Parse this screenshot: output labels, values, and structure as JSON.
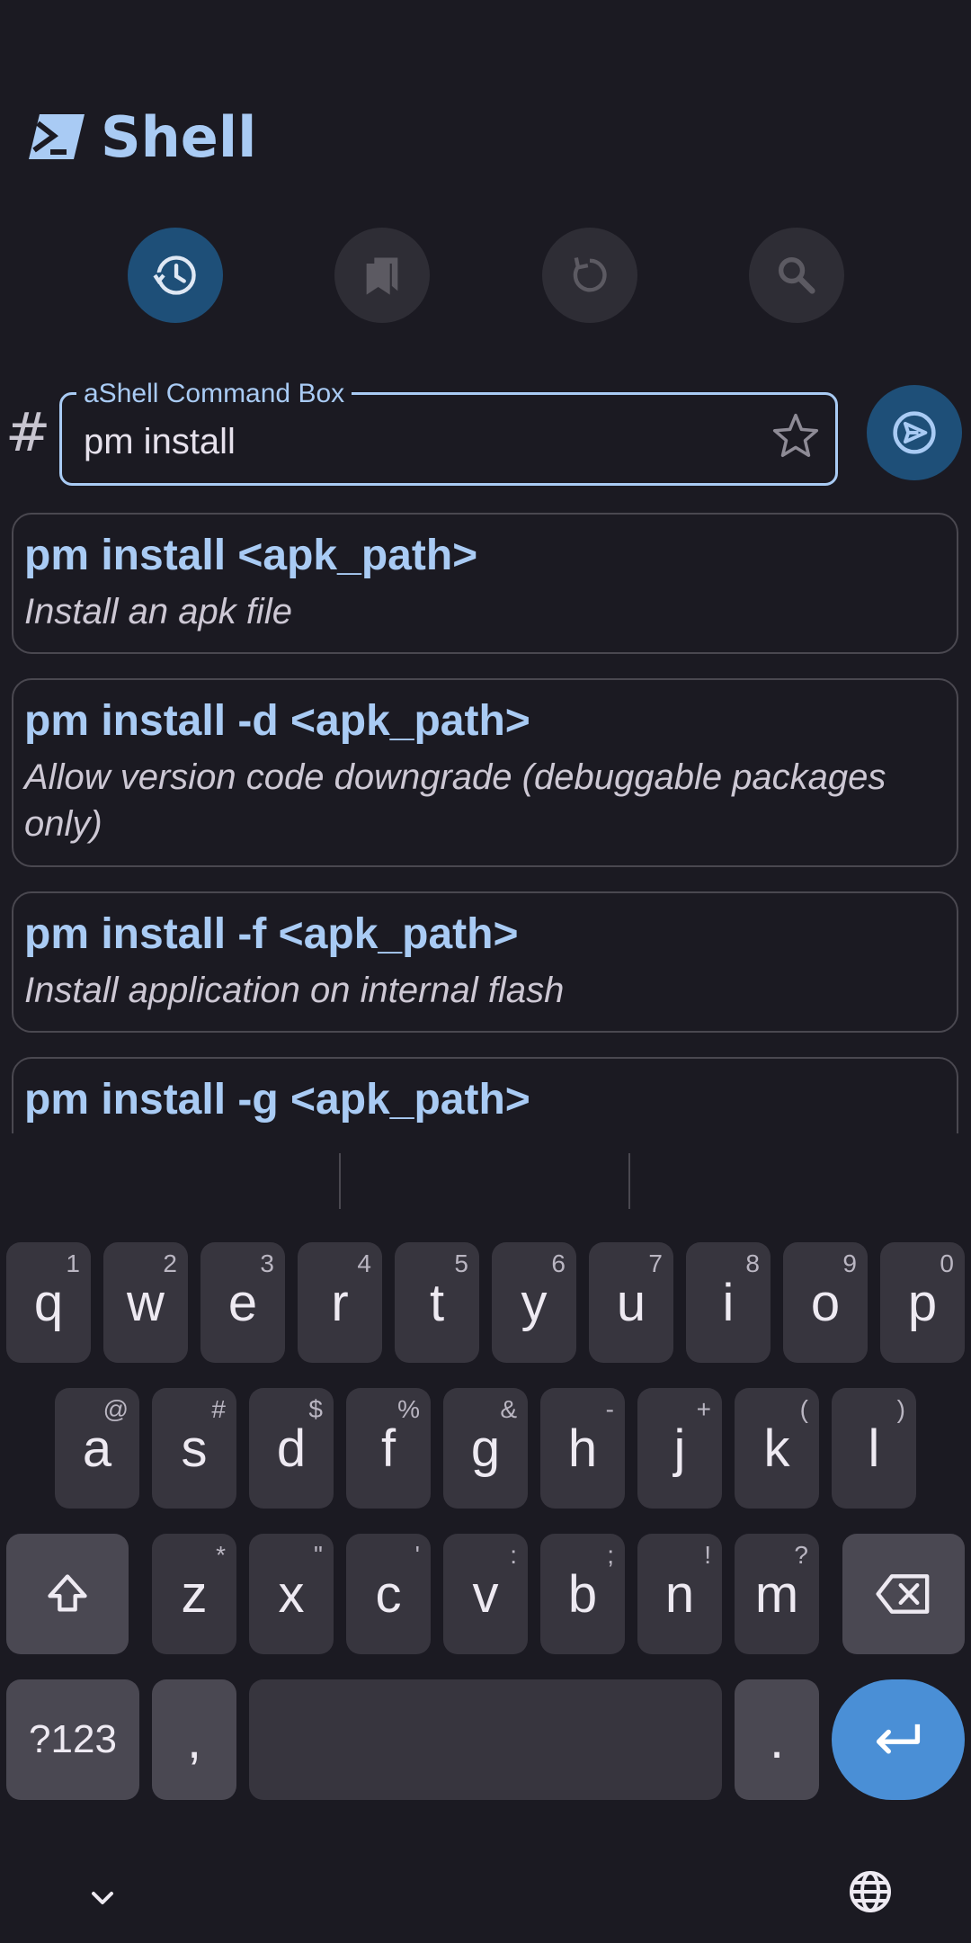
{
  "app": {
    "title": "Shell"
  },
  "actions": [
    {
      "name": "history-icon",
      "active": true
    },
    {
      "name": "bookmarks-icon",
      "active": false
    },
    {
      "name": "refresh-icon",
      "active": false
    },
    {
      "name": "search-icon",
      "active": false
    }
  ],
  "command_box": {
    "prompt_symbol": "#",
    "label": "aShell Command Box",
    "value": "pm install"
  },
  "suggestions": [
    {
      "command": "pm install <apk_path>",
      "description": "Install an apk file"
    },
    {
      "command": "pm install -d <apk_path>",
      "description": "Allow version code downgrade (debuggable packages only)"
    },
    {
      "command": "pm install -f <apk_path>",
      "description": "Install application on internal flash"
    },
    {
      "command": "pm install -g <apk_path>",
      "description": ""
    }
  ],
  "keyboard": {
    "row1": [
      {
        "k": "q",
        "h": "1"
      },
      {
        "k": "w",
        "h": "2"
      },
      {
        "k": "e",
        "h": "3"
      },
      {
        "k": "r",
        "h": "4"
      },
      {
        "k": "t",
        "h": "5"
      },
      {
        "k": "y",
        "h": "6"
      },
      {
        "k": "u",
        "h": "7"
      },
      {
        "k": "i",
        "h": "8"
      },
      {
        "k": "o",
        "h": "9"
      },
      {
        "k": "p",
        "h": "0"
      }
    ],
    "row2": [
      {
        "k": "a",
        "h": "@"
      },
      {
        "k": "s",
        "h": "#"
      },
      {
        "k": "d",
        "h": "$"
      },
      {
        "k": "f",
        "h": "%"
      },
      {
        "k": "g",
        "h": "&"
      },
      {
        "k": "h",
        "h": "-"
      },
      {
        "k": "j",
        "h": "+"
      },
      {
        "k": "k",
        "h": "("
      },
      {
        "k": "l",
        "h": ")"
      }
    ],
    "row3": [
      {
        "k": "z",
        "h": "*"
      },
      {
        "k": "x",
        "h": "\""
      },
      {
        "k": "c",
        "h": "'"
      },
      {
        "k": "v",
        "h": ":"
      },
      {
        "k": "b",
        "h": ";"
      },
      {
        "k": "n",
        "h": "!"
      },
      {
        "k": "m",
        "h": "?"
      }
    ],
    "symbols_label": "?123",
    "comma": ",",
    "period": "."
  },
  "colors": {
    "accent": "#a9cbf4",
    "active_button": "#1e4f78",
    "enter_key": "#4a8fd6",
    "background": "#1b1a22"
  }
}
